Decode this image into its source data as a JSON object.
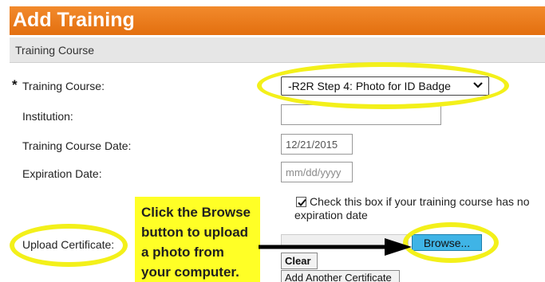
{
  "header": {
    "title": "Add Training"
  },
  "section": {
    "title": "Training Course"
  },
  "form": {
    "required_marker": "*",
    "training_course_label": "Training Course:",
    "training_course_value": "-R2R Step 4: Photo for ID Badge",
    "institution_label": "Institution:",
    "institution_value": "",
    "date_label": "Training Course Date:",
    "date_value": "12/21/2015",
    "expiration_label": "Expiration Date:",
    "expiration_placeholder": "mm/dd/yyyy",
    "no_expiration_label": "Check this box if your training course has no expiration date",
    "no_expiration_checked": true,
    "upload_label": "Upload Certificate:",
    "browse_label": "Browse...",
    "clear_label": "Clear",
    "add_certificate_label": "Add Another Certificate"
  },
  "annotation": {
    "lines": [
      "Click the Browse",
      "button to upload",
      "a photo from",
      "your computer."
    ],
    "highlight_color": "#f3f01a",
    "callout_color": "#ffff26"
  },
  "colors": {
    "header": "#e97a1c",
    "browse_button": "#3fb4e6"
  },
  "icons": {
    "select_arrow": "chevron-down-icon",
    "checkbox": "check-icon",
    "arrow": "arrow-right-icon"
  }
}
